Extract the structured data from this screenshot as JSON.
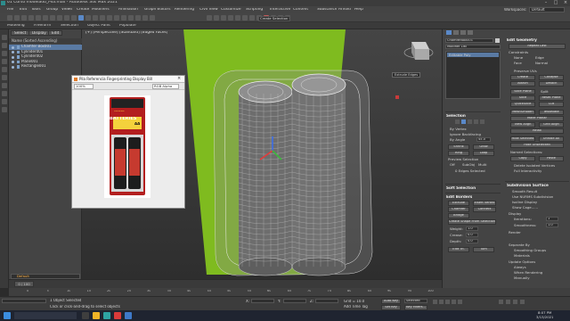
{
  "window": {
    "title": "01 Curso modelado_Pila.max - Autodesk 3ds Max 2021"
  },
  "menu": {
    "items": [
      "File",
      "Edit",
      "Tools",
      "Group",
      "Views",
      "Create",
      "Modifiers",
      "Animation",
      "Graph Editors",
      "Rendering",
      "Civil View",
      "Customize",
      "Scripting",
      "Interactive",
      "Content",
      "Substance",
      "Arnold",
      "Help"
    ],
    "workspace_label": "Workspaces:",
    "workspace_value": "Default"
  },
  "toolbar": {
    "selection_set": "Create Selection Se"
  },
  "ribbon": {
    "tabs": [
      "Modeling",
      "Freeform",
      "Selection",
      "Object Paint",
      "Populate"
    ]
  },
  "explorer": {
    "tabs": [
      "Select",
      "Display",
      "Edit"
    ],
    "header": "Name (Sorted Ascending)",
    "items": [
      "Chamfer Box001",
      "Cylinder001",
      "Cylinder002",
      "Plane001",
      "Rectangle001"
    ],
    "footer_label": "Default"
  },
  "viewport": {
    "label": "[+] [Perspective] [Standard] [Edged Faces]"
  },
  "refwindow": {
    "title": "Pila Referencia Fingerprinting Display Bill",
    "zoom": "100%",
    "mode": "RGB Alpha",
    "product_brand": "BATTERIES",
    "product_type": "ALKALINE",
    "product_size": "AA"
  },
  "cmdpanel": {
    "object_name": "ChamferBox001",
    "modifier_list": "Modifier List",
    "stack_item": "Editable Poly",
    "sections": {
      "edit_geometry": "Edit Geometry",
      "selection": "Selection",
      "soft_selection": "Soft Selection",
      "edit_borders": "Edit Borders",
      "subdivision_surface": "Subdivision Surface"
    },
    "edit_geometry": {
      "repeat_last": "Repeat Last",
      "constraints": "Constraints",
      "none": "None",
      "edge": "Edge",
      "face": "Face",
      "normal": "Normal",
      "preserve_uvs": "Preserve UVs",
      "create": "Create",
      "collapse": "Collapse",
      "attach": "Attach",
      "detach": "Detach",
      "slice_plane": "Slice Plane",
      "split": "Split",
      "slice": "Slice",
      "reset_plane": "Reset Plane",
      "quickslice": "QuickSlice",
      "cut": "Cut",
      "meshsmooth": "MeshSmooth",
      "tessellate": "Tessellate",
      "make_planar": "Make Planar",
      "view_align": "View Align",
      "grid_align": "Grid Align",
      "relax": "Relax",
      "hide_selected": "Hide Selected",
      "unhide_all": "Unhide All",
      "hide_unselected": "Hide Unselected",
      "named_selections": "Named Selections:",
      "copy": "Copy",
      "paste": "Paste",
      "delete_isolated": "Delete Isolated Vertices",
      "full_interactivity": "Full Interactivity"
    },
    "selection": {
      "by_vertex": "By Vertex",
      "ignore_backfacing": "Ignore Backfacing",
      "by_angle": "By Angle",
      "angle": "45.0",
      "shrink": "Shrink",
      "grow": "Grow",
      "ring": "Ring",
      "loop": "Loop",
      "preview_selection": "Preview Selection",
      "off": "Off",
      "subobj": "SubObj",
      "multi": "Multi",
      "status": "0 Edges Selected"
    },
    "edit_borders": {
      "extrude": "Extrude",
      "insert_vertex": "Insert Vertex",
      "chamfer": "Chamfer",
      "connect": "Connect",
      "bridge": "Bridge",
      "create_shape": "Create Shape From Selection",
      "weight": "Weight:",
      "weight_val": "1.0",
      "crease": "Crease:",
      "crease_val": "0.0",
      "depth": "Depth:",
      "depth_val": "0.0",
      "edit_tri": "Edit Tri.",
      "turn": "Turn"
    },
    "subdivision": {
      "smooth_result": "Smooth Result",
      "use_nurms": "Use NURMS Subdivision",
      "isoline_display": "Isoline Display",
      "show_cage": "Show Cage......",
      "display": "Display",
      "iterations": "Iterations:",
      "iterations_val": "1",
      "smoothness": "Smoothness:",
      "smoothness_val": "1.0",
      "render": "Render",
      "separate_by": "Separate By",
      "smoothing_groups": "Smoothing Groups",
      "materials": "Materials",
      "update_options": "Update Options",
      "always": "Always",
      "when_rendering": "When Rendering",
      "manually": "Manually"
    },
    "viewport_tags": {
      "extrude_edges": "Extrude Edges",
      "viewport_extra": "ViewCube"
    }
  },
  "timeline": {
    "frame": "0 / 100",
    "ticks": [
      "0",
      "5",
      "10",
      "15",
      "20",
      "25",
      "30",
      "35",
      "40",
      "45",
      "50",
      "55",
      "60",
      "65",
      "70",
      "75",
      "80",
      "85",
      "90",
      "95",
      "100"
    ]
  },
  "statusbar": {
    "status_line_1": "1 Object Selected",
    "status_line_2": "Click or click-and-drag to select objects",
    "x_label": "X:",
    "y_label": "Y:",
    "z_label": "Z:",
    "grid": "Grid = 10.0",
    "add_time_tag": "Add Time Tag",
    "auto_key": "Auto Key",
    "selected": "Selected",
    "set_key": "Set Key",
    "key_filters": "Key Filters..."
  },
  "taskbar": {
    "time": "8:07 PM",
    "date": "3/13/2021"
  },
  "colors": {
    "viewport_green": "#7fbb1f",
    "accent_blue": "#5a89c8",
    "battery_red": "#c63a2f"
  }
}
